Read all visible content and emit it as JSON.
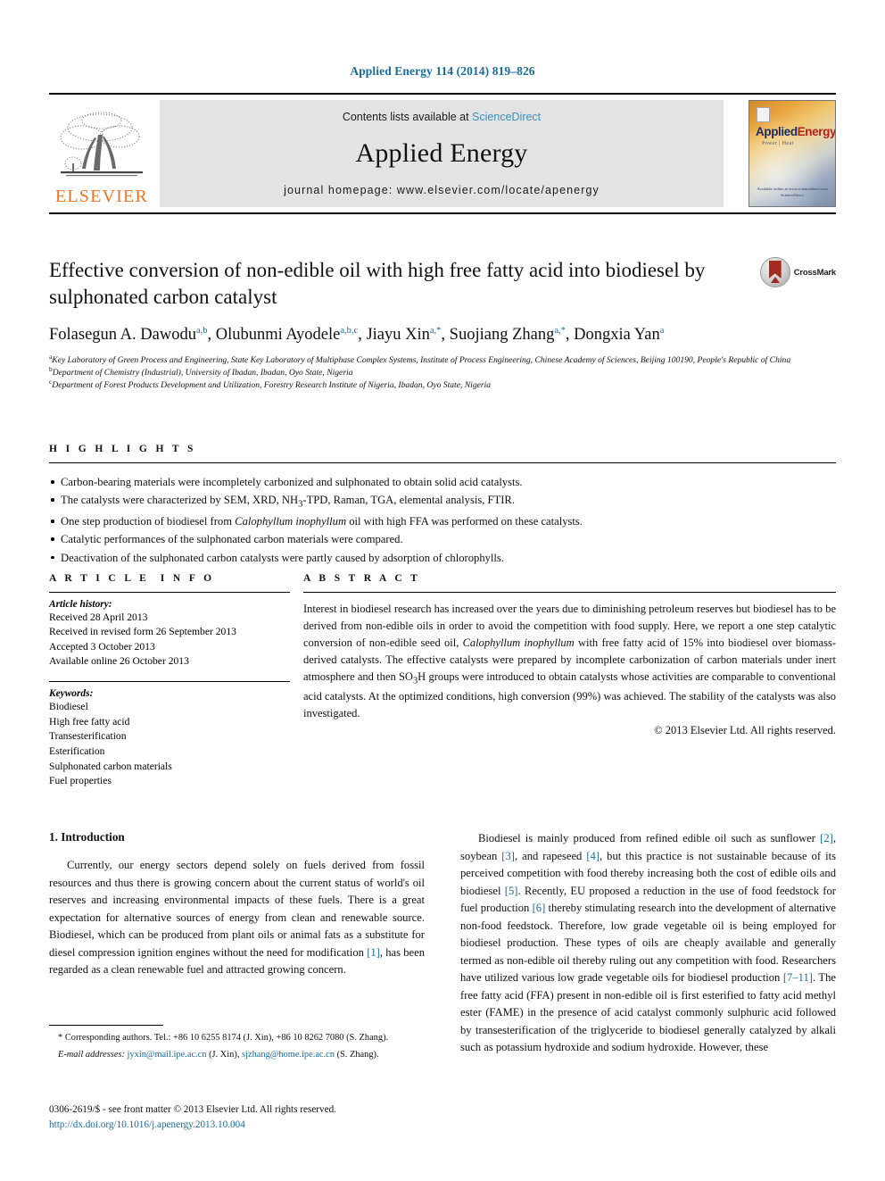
{
  "running_head": "Applied Energy 114 (2014) 819–826",
  "masthead": {
    "publisher_name": "ELSEVIER",
    "contents_line_prefix": "Contents lists available at ",
    "sciencedirect": "ScienceDirect",
    "journal_title": "Applied Energy",
    "homepage_line": "journal homepage: www.elsevier.com/locate/apenergy",
    "cover": {
      "title_part1": "Applied",
      "title_part2": "Energy",
      "subtitle": "Power | Heat",
      "footer_line1": "Available online at www.sciencedirect.com",
      "footer_line2": "ScienceDirect"
    }
  },
  "article": {
    "title": "Effective conversion of non-edible oil with high free fatty acid into biodiesel by sulphonated carbon catalyst",
    "crossmark_label": "CrossMark",
    "authors": [
      {
        "name": "Folasegun A. Dawodu",
        "marks": "a,b",
        "sep": ", "
      },
      {
        "name": "Olubunmi Ayodele",
        "marks": "a,b,c",
        "sep": ", "
      },
      {
        "name": "Jiayu Xin",
        "marks": "a,*",
        "sep": ", "
      },
      {
        "name": "Suojiang Zhang",
        "marks": "a,*",
        "sep": ", "
      },
      {
        "name": "Dongxia Yan",
        "marks": "a",
        "sep": ""
      }
    ],
    "affiliations": [
      {
        "mark": "a",
        "text": "Key Laboratory of Green Process and Engineering, State Key Laboratory of Multiphase Complex Systems, Institute of Process Engineering, Chinese Academy of Sciences, Beijing 100190, People's Republic of China"
      },
      {
        "mark": "b",
        "text": "Department of Chemistry (Industrial), University of Ibadan, Ibadan, Oyo State, Nigeria"
      },
      {
        "mark": "c",
        "text": "Department of Forest Products Development and Utilization, Forestry Research Institute of Nigeria, Ibadan, Oyo State, Nigeria"
      }
    ]
  },
  "highlights": {
    "heading": "HIGHLIGHTS",
    "items": [
      "Carbon-bearing materials were incompletely carbonized and sulphonated to obtain solid acid catalysts.",
      "The catalysts were characterized by SEM, XRD, NH3-TPD, Raman, TGA, elemental analysis, FTIR.",
      "One step production of biodiesel from Calophyllum inophyllum oil with high FFA was performed on these catalysts.",
      "Catalytic performances of the sulphonated carbon materials were compared.",
      "Deactivation of the sulphonated carbon catalysts were partly caused by adsorption of chlorophylls."
    ]
  },
  "article_info": {
    "heading": "ARTICLE INFO",
    "history_label": "Article history:",
    "history": [
      "Received 28 April 2013",
      "Received in revised form 26 September 2013",
      "Accepted 3 October 2013",
      "Available online 26 October 2013"
    ],
    "keywords_label": "Keywords:",
    "keywords": [
      "Biodiesel",
      "High free fatty acid",
      "Transesterification",
      "Esterification",
      "Sulphonated carbon materials",
      "Fuel properties"
    ]
  },
  "abstract": {
    "heading": "ABSTRACT",
    "text_part1": "Interest in biodiesel research has increased over the years due to diminishing petroleum reserves but biodiesel has to be derived from non-edible oils in order to avoid the competition with food supply. Here, we report a one step catalytic conversion of non-edible seed oil, ",
    "species": "Calophyllum inophyllum",
    "text_part2": " with free fatty acid of 15% into biodiesel over biomass-derived catalysts. The effective catalysts were prepared by incomplete carbonization of carbon materials under inert atmosphere and then SO3H groups were introduced to obtain catalysts whose activities are comparable to conventional acid catalysts. At the optimized conditions, high conversion (99%) was achieved. The stability of the catalysts was also investigated.",
    "copyright": "© 2013 Elsevier Ltd. All rights reserved."
  },
  "introduction": {
    "heading": "1. Introduction",
    "left_paragraph_a": "Currently, our energy sectors depend solely on fuels derived from fossil resources and thus there is growing concern about the current status of world's oil reserves and increasing environmental impacts of these fuels. There is a great expectation for alternative sources of energy from clean and renewable source. Biodiesel, which can be produced from plant oils or animal fats as a substitute for diesel compression ignition engines without the need for modification ",
    "left_ref_1": "[1]",
    "left_paragraph_b": ", has been regarded as a clean renewable fuel and attracted growing concern.",
    "right_segments": [
      {
        "type": "text",
        "value": "Biodiesel is mainly produced from refined edible oil such as sunflower "
      },
      {
        "type": "ref",
        "value": "[2]"
      },
      {
        "type": "text",
        "value": ", soybean "
      },
      {
        "type": "ref",
        "value": "[3]"
      },
      {
        "type": "text",
        "value": ", and rapeseed "
      },
      {
        "type": "ref",
        "value": "[4]"
      },
      {
        "type": "text",
        "value": ", but this practice is not sustainable because of its perceived competition with food thereby increasing both the cost of edible oils and biodiesel "
      },
      {
        "type": "ref",
        "value": "[5]"
      },
      {
        "type": "text",
        "value": ". Recently, EU proposed a reduction in the use of food feedstock for fuel production "
      },
      {
        "type": "ref",
        "value": "[6]"
      },
      {
        "type": "text",
        "value": " thereby stimulating research into the development of alternative non-food feedstock. Therefore, low grade vegetable oil is being employed for biodiesel production. These types of oils are cheaply available and generally termed as non-edible oil thereby ruling out any competition with food. Researchers have utilized various low grade vegetable oils for biodiesel production "
      },
      {
        "type": "ref",
        "value": "[7–11]"
      },
      {
        "type": "text",
        "value": ". The free fatty acid (FFA) present in non-edible oil is first esterified to fatty acid methyl ester (FAME) in the presence of acid catalyst commonly sulphuric acid followed by transesterification of the triglyceride to biodiesel generally catalyzed by alkali such as potassium hydroxide and sodium hydroxide. However, these"
      }
    ]
  },
  "footnotes": {
    "corresponding_marker": "*",
    "corresponding_text": "Corresponding authors. Tel.: +86 10 6255 8174 (J. Xin), +86 10 8262 7080 (S. Zhang).",
    "email_label": "E-mail addresses:",
    "email_1": "jyxin@mail.ipe.ac.cn",
    "email_1_owner": "(J. Xin)",
    "email_2": "sjzhang@home.ipe.ac.cn",
    "email_2_owner": "(S. Zhang)."
  },
  "imprint": {
    "front_matter": "0306-2619/$ - see front matter © 2013 Elsevier Ltd. All rights reserved.",
    "doi": "http://dx.doi.org/10.1016/j.apenergy.2013.10.004"
  },
  "colors": {
    "link": "#1b6b9c",
    "elsevier_orange": "#E87722",
    "banner_bg": "#e3e3e3"
  }
}
